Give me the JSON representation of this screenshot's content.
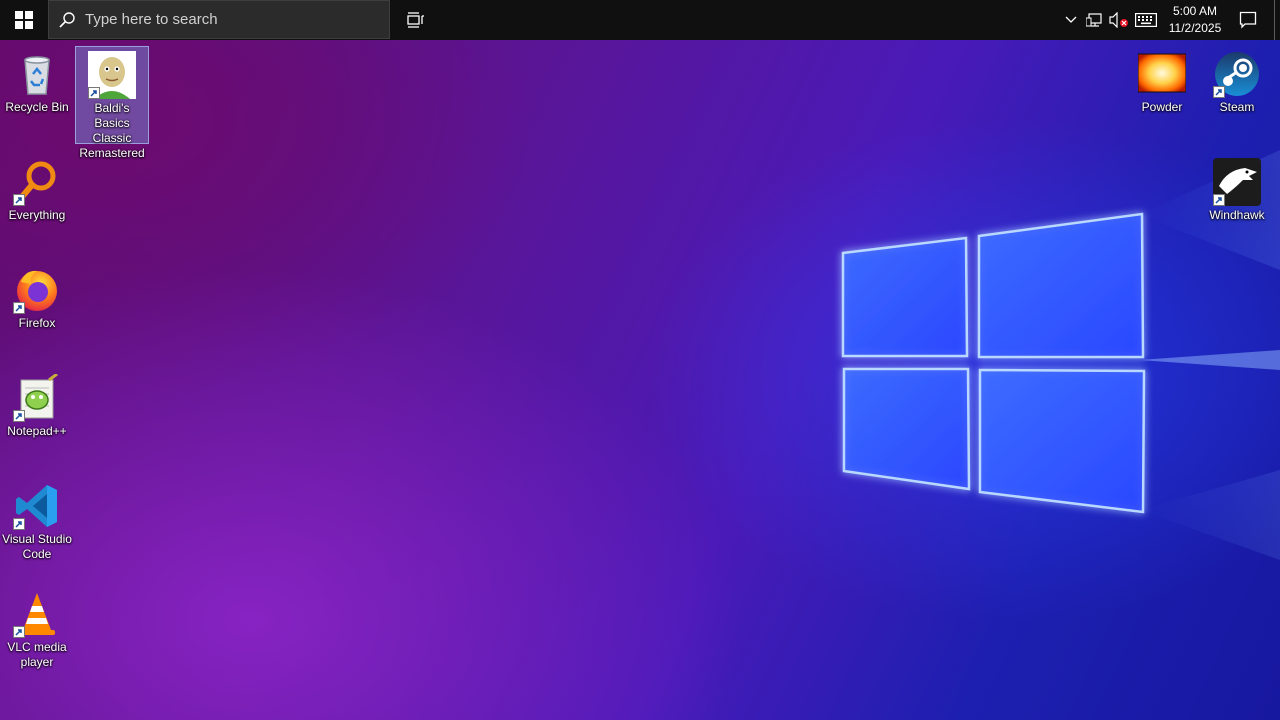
{
  "taskbar": {
    "search_placeholder": "Type here to search",
    "clock": {
      "time": "5:00 AM",
      "date": "11/2/2025"
    }
  },
  "desktop": {
    "icons_left": [
      {
        "label": "Recycle Bin",
        "icon": "recycle-bin-icon"
      },
      {
        "label": "Baldi's Basics Classic Remastered",
        "icon": "baldi-icon",
        "selected": true
      },
      {
        "label": "Everything",
        "icon": "everything-icon"
      },
      {
        "label": "Firefox",
        "icon": "firefox-icon"
      },
      {
        "label": "Notepad++",
        "icon": "notepadpp-icon"
      },
      {
        "label": "Visual Studio Code",
        "icon": "vscode-icon"
      },
      {
        "label": "VLC media player",
        "icon": "vlc-icon"
      }
    ],
    "icons_right": [
      {
        "label": "Powder",
        "icon": "powder-icon"
      },
      {
        "label": "Steam",
        "icon": "steam-icon"
      },
      {
        "label": "Windhawk",
        "icon": "windhawk-icon"
      }
    ]
  },
  "colors": {
    "taskbar": "#101010",
    "logo_glow": "#2f7bff",
    "selection": "#7896dc"
  }
}
